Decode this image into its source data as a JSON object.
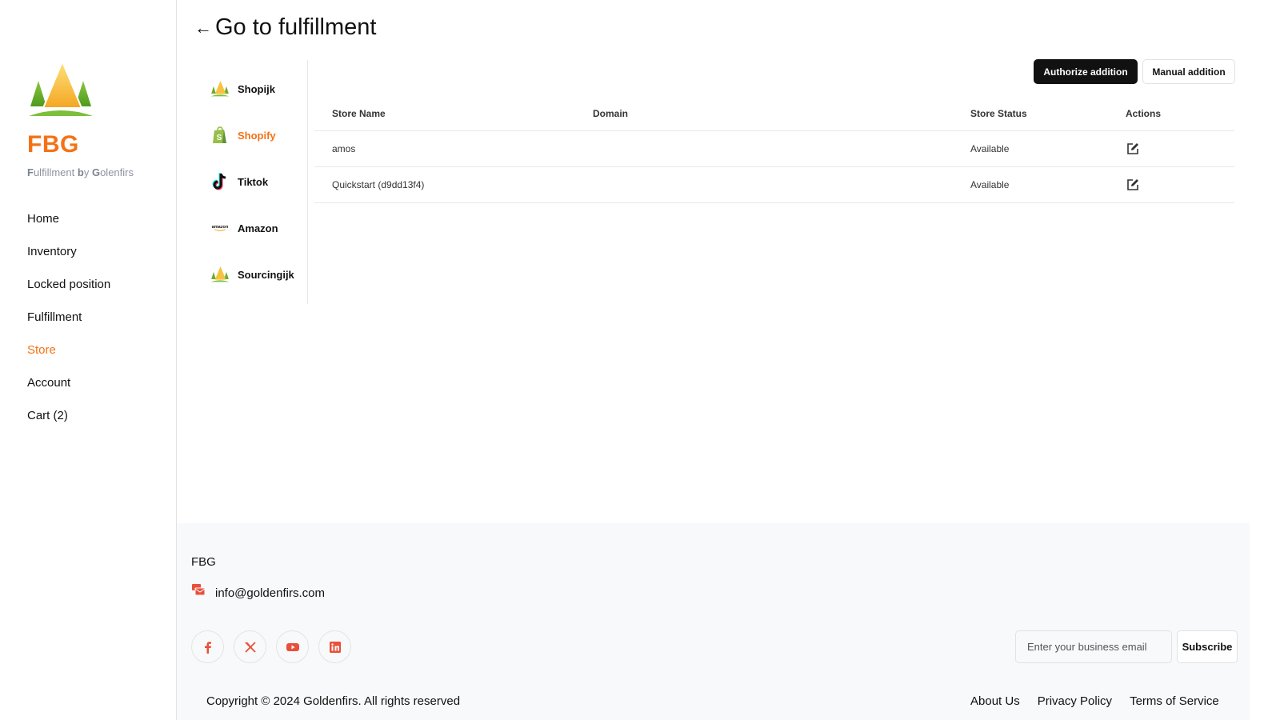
{
  "sidebar": {
    "brand": "FBG",
    "tagline": {
      "parts": [
        "F",
        "ulfillment ",
        "b",
        "y ",
        "G",
        "olenfirs"
      ]
    },
    "nav": [
      {
        "label": "Home",
        "active": false
      },
      {
        "label": "Inventory",
        "active": false
      },
      {
        "label": "Locked position",
        "active": false
      },
      {
        "label": "Fulfillment",
        "active": false
      },
      {
        "label": "Store",
        "active": true
      },
      {
        "label": "Account",
        "active": false
      },
      {
        "label": "Cart (2)",
        "active": false
      }
    ]
  },
  "header": {
    "back_arrow": "←",
    "title": "Go to fulfillment"
  },
  "store_tabs": [
    {
      "label": "Shopijk",
      "icon": "fir-tree-logo-icon",
      "active": false
    },
    {
      "label": "Shopify",
      "icon": "shopify-bag-icon",
      "active": true
    },
    {
      "label": "Tiktok",
      "icon": "tiktok-icon",
      "active": false
    },
    {
      "label": "Amazon",
      "icon": "amazon-logo-icon",
      "active": false
    },
    {
      "label": "Sourcingijk",
      "icon": "fir-tree-logo-icon",
      "active": false
    }
  ],
  "toolbar": {
    "authorize_label": "Authorize addition",
    "manual_label": "Manual addition"
  },
  "table": {
    "columns": [
      "Store Name",
      "Domain",
      "Store Status",
      "Actions"
    ],
    "rows": [
      {
        "store_name": "amos",
        "domain": "",
        "status": "Available",
        "action_icon": "edit-icon"
      },
      {
        "store_name": "Quickstart (d9dd13f4)",
        "domain": "",
        "status": "Available",
        "action_icon": "edit-icon"
      }
    ]
  },
  "footer": {
    "brand": "FBG",
    "email": "info@goldenfirs.com",
    "socials": [
      "facebook-icon",
      "x-twitter-icon",
      "youtube-icon",
      "linkedin-icon"
    ],
    "subscribe_placeholder": "Enter your business email",
    "subscribe_label": "Subscribe",
    "copyright": "Copyright © 2024 Goldenfirs. All rights reserved",
    "links": [
      "About Us",
      "Privacy Policy",
      "Terms of Service"
    ]
  },
  "colors": {
    "accent": "#f47216",
    "social_red": "#e8503a",
    "footer_bg": "#f8f9fb"
  }
}
